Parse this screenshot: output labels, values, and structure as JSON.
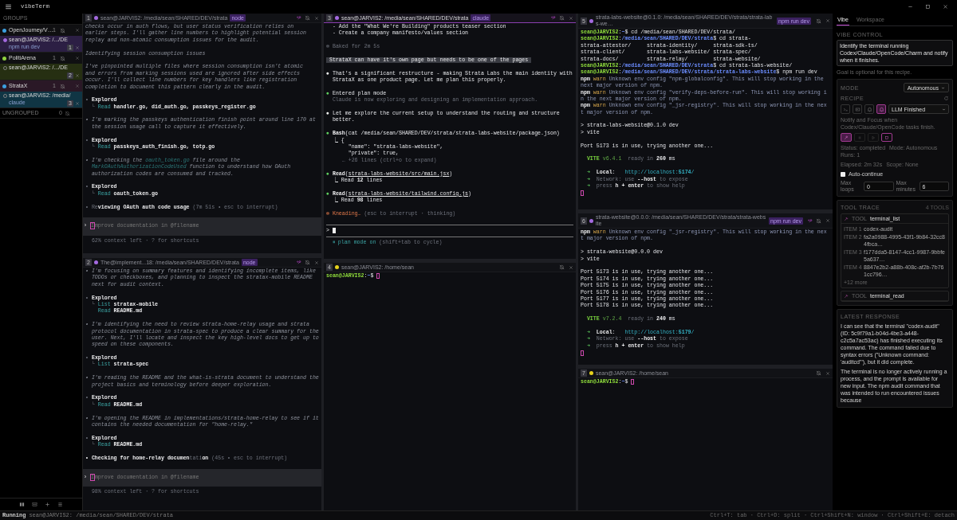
{
  "app": {
    "title": "vibeTerm"
  },
  "sidebar": {
    "heading": "GROUPS",
    "groups": [
      {
        "name": "OpenJourney/V…",
        "count": "1",
        "color": "#3b9fe0",
        "selected": false,
        "children": [
          {
            "title": "sean@JARVIS2: /.../DE",
            "subtitle": "npm run dev",
            "badge": "1",
            "color": "#2c1f44",
            "running": true
          }
        ]
      },
      {
        "name": "PolitiArena",
        "count": "1",
        "color": "#8fd13f",
        "selected": false,
        "children": [
          {
            "title": "sean@JARVIS2: /.../DE",
            "badge": "2",
            "color": "#262f12",
            "running": false
          }
        ]
      },
      {
        "name": "StrataX",
        "count": "1",
        "color": "#3b9fe0",
        "selected": true,
        "children": [
          {
            "title": "sean@JARVIS2: /media/",
            "subtitle": "claude",
            "badge": "3",
            "color": "#103544",
            "running": false
          }
        ]
      }
    ],
    "ungrouped": {
      "label": "UNGROUPED",
      "count": "0"
    }
  },
  "columns": [
    {
      "panes": [
        {
          "number": "1",
          "color": "#a46ae0",
          "title": "sean@JARVIS2: /media/sean/SHARED/DEV/strata",
          "tag": "node",
          "active": false,
          "watched": true,
          "blocks": [
            [
              [
                {
                  "kind": "thought",
                  "text": "checks occur in auth flows, but user status verification relies on"
                }
              ],
              [
                {
                  "kind": "thought",
                  "text": "earlier steps. I'll gather line numbers to highlight potential session"
                }
              ],
              [
                {
                  "kind": "thought",
                  "text": "replay and non-atomic consumption issues for the audit."
                }
              ]
            ],
            [
              [
                {
                  "kind": "thought",
                  "text": "Identifying session consumption issues"
                }
              ]
            ],
            [
              [
                {
                  "kind": "thought",
                  "text": "I've pinpointed multiple files where session consumption isn't atomic"
                }
              ],
              [
                {
                  "kind": "thought",
                  "text": "and errors from marking sessions used are ignored after side effects"
                }
              ],
              [
                {
                  "kind": "thought",
                  "text": "occur. I'll collect line numbers for key handlers like registration"
                }
              ],
              [
                {
                  "kind": "thought",
                  "text": "completion to document this pattern clearly in the audit."
                }
              ]
            ],
            [
              [
                {
                  "kind": "dim",
                  "text": "• "
                },
                {
                  "kind": "bold",
                  "text": "Explored"
                }
              ],
              [
                {
                  "kind": "dim",
                  "text": "  └ "
                },
                {
                  "kind": "teal",
                  "text": "Read"
                },
                {
                  "kind": "bold",
                  "text": " handler.go, did_auth.go, passkeys_register.go"
                }
              ]
            ],
            [
              [
                {
                  "kind": "thought",
                  "text": "• I'm marking the passkeys authentication finish point around line 170 at"
                }
              ],
              [
                {
                  "kind": "thought",
                  "text": "  the session usage call to capture it effectively."
                }
              ]
            ],
            [
              [
                {
                  "kind": "dim",
                  "text": "• "
                },
                {
                  "kind": "bold",
                  "text": "Explored"
                }
              ],
              [
                {
                  "kind": "dim",
                  "text": "  └ "
                },
                {
                  "kind": "teal",
                  "text": "Read"
                },
                {
                  "kind": "bold",
                  "text": " passkeys_auth_finish.go, totp.go"
                }
              ]
            ],
            [
              [
                {
                  "kind": "thought",
                  "text": "• I'm checking the "
                },
                {
                  "kind": "link",
                  "text": "oauth_token.go"
                },
                {
                  "kind": "thought",
                  "text": " file around the"
                }
              ],
              [
                {
                  "kind": "link",
                  "text": "  MarkOAuthAuthorizationCodeUsed"
                },
                {
                  "kind": "thought",
                  "text": " function to understand how OAuth"
                }
              ],
              [
                {
                  "kind": "thought",
                  "text": "  authorization codes are consumed and tracked."
                }
              ]
            ],
            [
              [
                {
                  "kind": "dim",
                  "text": "• "
                },
                {
                  "kind": "bold",
                  "text": "Explored"
                }
              ],
              [
                {
                  "kind": "dim",
                  "text": "  └ "
                },
                {
                  "kind": "teal",
                  "text": "Read"
                },
                {
                  "kind": "bold",
                  "text": " oauth_token.go"
                }
              ]
            ],
            [
              [
                {
                  "kind": "dim",
                  "text": "• Re"
                },
                {
                  "kind": "bold",
                  "text": "viewing OAuth auth code usage"
                },
                {
                  "kind": "dim",
                  "text": " (7m 51s • esc to interrupt)"
                }
              ]
            ]
          ],
          "input": {
            "kind": "codex",
            "prompt": "›",
            "placeholder": "Improve documentation in @filename"
          },
          "footer": [
            {
              "kind": "dim",
              "text": "  62% context left · ? for shortcuts"
            }
          ]
        },
        {
          "number": "2",
          "color": "#a46ae0",
          "title": "The@implement...18: /media/sean/SHARED/DEV/strata",
          "tag": "node",
          "active": false,
          "watched": true,
          "blocks": [
            [
              [
                {
                  "kind": "thought",
                  "text": "• I'm focusing on summary features and identifying incomplete items, like"
                }
              ],
              [
                {
                  "kind": "thought",
                  "text": "  TODOs or checkboxes, and planning to inspect the stratax-mobile README"
                }
              ],
              [
                {
                  "kind": "thought",
                  "text": "  next for audit context."
                }
              ]
            ],
            [
              [
                {
                  "kind": "dim",
                  "text": "• "
                },
                {
                  "kind": "bold",
                  "text": "Explored"
                }
              ],
              [
                {
                  "kind": "dim",
                  "text": "  └ "
                },
                {
                  "kind": "teal",
                  "text": "List"
                },
                {
                  "kind": "bold",
                  "text": " stratax-mobile"
                }
              ],
              [
                {
                  "kind": "teal",
                  "text": "    Read"
                },
                {
                  "kind": "bold",
                  "text": " README.md"
                }
              ]
            ],
            [
              [
                {
                  "kind": "thought",
                  "text": "• I'm identifying the need to review strata-home-relay usage and strata"
                }
              ],
              [
                {
                  "kind": "thought",
                  "text": "  protocol documentation in strata-spec to produce a clear summary for the"
                }
              ],
              [
                {
                  "kind": "thought",
                  "text": "  user. Next, I'll locate and inspect the key high-level docs to get up to"
                }
              ],
              [
                {
                  "kind": "thought",
                  "text": "  speed on these components."
                }
              ]
            ],
            [
              [
                {
                  "kind": "dim",
                  "text": "• "
                },
                {
                  "kind": "bold",
                  "text": "Explored"
                }
              ],
              [
                {
                  "kind": "dim",
                  "text": "  └ "
                },
                {
                  "kind": "teal",
                  "text": "List"
                },
                {
                  "kind": "bold",
                  "text": " strata-spec"
                }
              ]
            ],
            [
              [
                {
                  "kind": "thought",
                  "text": "• I'm reading the README and the what-is-strata document to understand the"
                }
              ],
              [
                {
                  "kind": "thought",
                  "text": "  project basics and terminology before deeper exploration."
                }
              ]
            ],
            [
              [
                {
                  "kind": "dim",
                  "text": "• "
                },
                {
                  "kind": "bold",
                  "text": "Explored"
                }
              ],
              [
                {
                  "kind": "dim",
                  "text": "  └ "
                },
                {
                  "kind": "teal",
                  "text": "Read"
                },
                {
                  "kind": "bold",
                  "text": " README.md"
                }
              ]
            ],
            [
              [
                {
                  "kind": "thought",
                  "text": "• I'm opening the README in implementations/strata-home-relay to see if it"
                }
              ],
              [
                {
                  "kind": "thought",
                  "text": "  contains the needed documentation for \"home-relay.\""
                }
              ]
            ],
            [
              [
                {
                  "kind": "dim",
                  "text": "• "
                },
                {
                  "kind": "bold",
                  "text": "Explored"
                }
              ],
              [
                {
                  "kind": "dim",
                  "text": "  └ "
                },
                {
                  "kind": "teal",
                  "text": "Read"
                },
                {
                  "kind": "bold",
                  "text": " README.md"
                }
              ]
            ],
            [
              [
                {
                  "kind": "bold",
                  "text": "• Checking for home-relay documen"
                },
                {
                  "kind": "dim",
                  "text": "tati"
                },
                {
                  "kind": "bold",
                  "text": "on"
                },
                {
                  "kind": "dim",
                  "text": " (45s • esc to interrupt)"
                }
              ]
            ]
          ],
          "input": {
            "kind": "codex",
            "prompt": "›",
            "placeholder": "Improve documentation in @filename"
          },
          "footer": [
            {
              "kind": "dim",
              "text": "  98% context left · ? for shortcuts"
            }
          ]
        }
      ]
    },
    {
      "panes": [
        {
          "number": "3",
          "color": "#a46ae0",
          "title": "sean@JARVIS2: /media/sean/SHARED/DEV/strata",
          "tag": "claude",
          "active": true,
          "watched": true,
          "blocks": [
            [
              [
                {
                  "kind": "white",
                  "text": "  - Add the \"What We're Building\" products teaser section"
                }
              ],
              [
                {
                  "kind": "white",
                  "text": "  - Create a company manifesto/values section"
                }
              ]
            ],
            [
              [
                {
                  "kind": "dim",
                  "text": "✻ Baked for 2m 5s"
                }
              ]
            ],
            [
              [
                {
                  "kind": "highlight",
                  "text": " StrataX can have it's own page but needs to be one of the pages "
                }
              ]
            ],
            [
              [
                {
                  "kind": "bullet",
                  "text": "● "
                },
                {
                  "kind": "white",
                  "text": "That's a significant restructure - making Strata Labs the main identity with"
                }
              ],
              [
                {
                  "kind": "white",
                  "text": "  StrataX as one product page. Let me plan this properly."
                }
              ]
            ],
            [
              [
                {
                  "kind": "bullet-ok",
                  "text": "● "
                },
                {
                  "kind": "white",
                  "text": "Entered plan mode"
                }
              ],
              [
                {
                  "kind": "dim",
                  "text": "  Claude is now exploring and designing an implementation approach."
                }
              ]
            ],
            [
              [
                {
                  "kind": "bullet",
                  "text": "● "
                },
                {
                  "kind": "white",
                  "text": "Let me explore the current setup to understand the routing and structure"
                }
              ],
              [
                {
                  "kind": "white",
                  "text": "  better."
                }
              ]
            ],
            [
              [
                {
                  "kind": "bullet-ok",
                  "text": "● "
                },
                {
                  "kind": "bold",
                  "text": "Bash"
                },
                {
                  "kind": "white",
                  "text": "(cat /media/sean/SHARED/DEV/strata/strata-labs-website/package.json)"
                }
              ],
              [
                {
                  "kind": "white",
                  "text": "  ⎿ {"
                }
              ],
              [
                {
                  "kind": "white",
                  "text": "       \"name\": \"strata-labs-website\","
                }
              ],
              [
                {
                  "kind": "white",
                  "text": "       \"private\": true,"
                }
              ],
              [
                {
                  "kind": "dim",
                  "text": "     … +26 lines (ctrl+o to expand)"
                }
              ]
            ],
            [
              [
                {
                  "kind": "bullet-ok",
                  "text": "● "
                },
                {
                  "kind": "bold",
                  "text": "Read"
                },
                {
                  "kind": "white",
                  "text": "("
                },
                {
                  "kind": "underline",
                  "text": "strata-labs-website/src/main.jsx"
                },
                {
                  "kind": "white",
                  "text": ")"
                }
              ],
              [
                {
                  "kind": "white",
                  "text": "  ⎿ Read "
                },
                {
                  "kind": "bold",
                  "text": "12"
                },
                {
                  "kind": "white",
                  "text": " lines"
                }
              ]
            ],
            [
              [
                {
                  "kind": "bullet-ok",
                  "text": "● "
                },
                {
                  "kind": "bold",
                  "text": "Read"
                },
                {
                  "kind": "white",
                  "text": "("
                },
                {
                  "kind": "underline",
                  "text": "strata-labs-website/tailwind.config.js"
                },
                {
                  "kind": "white",
                  "text": ")"
                }
              ],
              [
                {
                  "kind": "white",
                  "text": "  ⎿ Read "
                },
                {
                  "kind": "bold",
                  "text": "98"
                },
                {
                  "kind": "white",
                  "text": " lines"
                }
              ]
            ],
            [
              [
                {
                  "kind": "orange",
                  "text": "✻ Kneading…"
                },
                {
                  "kind": "dim",
                  "text": " (esc to interrupt · thinking)"
                }
              ]
            ]
          ],
          "input": {
            "kind": "claude",
            "prompt": ">"
          },
          "footer": [
            {
              "kind": "teal",
              "text": "  ⏸ plan mode on"
            },
            {
              "kind": "dim",
              "text": " (shift+tab to cycle)"
            }
          ]
        },
        {
          "number": "4",
          "color": "#e6d21c",
          "title": "sean@JARVIS2: /home/sean",
          "active": false,
          "watched": false,
          "blocks": [
            [
              [
                {
                  "kind": "prompt",
                  "text": "sean@JARVIS2"
                },
                {
                  "kind": "white",
                  "text": ":"
                },
                {
                  "kind": "path",
                  "text": "~"
                },
                {
                  "kind": "white",
                  "text": "$ "
                },
                {
                  "kind": "cursor"
                }
              ]
            ]
          ]
        }
      ]
    },
    {
      "panes": [
        {
          "number": "5",
          "color": "#a46ae0",
          "title": "strata-labs-website@0.1.0: /media/sean/SHARED/DEV/strata/strata-labs-we…",
          "tag": "npm run dev",
          "active": false,
          "watched": false,
          "blocks": [
            [
              [
                {
                  "kind": "prompt",
                  "text": "sean@JARVIS2"
                },
                {
                  "kind": "white",
                  "text": ":"
                },
                {
                  "kind": "path",
                  "text": "~"
                },
                {
                  "kind": "white",
                  "text": "$ cd /media/sean/SHARED/DEV/strata/"
                }
              ],
              [
                {
                  "kind": "prompt",
                  "text": "sean@JARVIS2"
                },
                {
                  "kind": "white",
                  "text": ":"
                },
                {
                  "kind": "path",
                  "text": "/media/sean/SHARED/DEV/strata"
                },
                {
                  "kind": "white",
                  "text": "$ cd strata-"
                }
              ],
              [
                {
                  "kind": "white",
                  "text": "strata-attestor/     strata-identity/     strata-sdk-ts/"
                }
              ],
              [
                {
                  "kind": "white",
                  "text": "strata-client/       strata-labs-website/ strata-spec/"
                }
              ],
              [
                {
                  "kind": "white",
                  "text": "strata-docs/         strata-relay/        strata-website/"
                }
              ],
              [
                {
                  "kind": "prompt",
                  "text": "sean@JARVIS2"
                },
                {
                  "kind": "white",
                  "text": ":"
                },
                {
                  "kind": "path",
                  "text": "/media/sean/SHARED/DEV/strata"
                },
                {
                  "kind": "white",
                  "text": "$ cd strata-labs-website/"
                }
              ],
              [
                {
                  "kind": "prompt",
                  "text": "sean@JARVIS2"
                },
                {
                  "kind": "white",
                  "text": ":"
                },
                {
                  "kind": "path",
                  "text": "/media/sean/SHARED/DEV/strata/strata-labs-website"
                },
                {
                  "kind": "white",
                  "text": "$ npm run dev"
                }
              ],
              [
                {
                  "kind": "bold",
                  "text": "npm"
                },
                {
                  "kind": "warn",
                  "text": " warn"
                },
                {
                  "kind": "note",
                  "text": " Unknown env config \"npm-globalconfig\". This will stop working in the"
                }
              ],
              [
                {
                  "kind": "note",
                  "text": "next major version of npm."
                }
              ],
              [
                {
                  "kind": "bold",
                  "text": "npm"
                },
                {
                  "kind": "warn",
                  "text": " warn"
                },
                {
                  "kind": "note",
                  "text": " Unknown env config \"verify-deps-before-run\". This will stop working i"
                }
              ],
              [
                {
                  "kind": "note",
                  "text": "n the next major version of npm."
                }
              ],
              [
                {
                  "kind": "bold",
                  "text": "npm"
                },
                {
                  "kind": "warn",
                  "text": " warn"
                },
                {
                  "kind": "note",
                  "text": " Unknown env config \"_jsr-registry\". This will stop working in the nex"
                }
              ],
              [
                {
                  "kind": "note",
                  "text": "t major version of npm."
                }
              ]
            ],
            [
              [
                {
                  "kind": "white",
                  "text": "> strata-labs-website@0.1.0 dev"
                }
              ],
              [
                {
                  "kind": "white",
                  "text": "> vite"
                }
              ]
            ],
            [
              [
                {
                  "kind": "white",
                  "text": "Port 5173 is in use, trying another one..."
                }
              ]
            ],
            [
              [
                {
                  "kind": "vite",
                  "text": "  VITE"
                },
                {
                  "kind": "version",
                  "text": " v6.4.1"
                },
                {
                  "kind": "dim",
                  "text": "  ready in "
                },
                {
                  "kind": "bold",
                  "text": "260"
                },
                {
                  "kind": "white",
                  "text": " ms"
                }
              ]
            ],
            [
              [
                {
                  "kind": "green",
                  "text": "  ➜  "
                },
                {
                  "kind": "bold",
                  "text": "Local"
                },
                {
                  "kind": "white",
                  "text": ":   "
                },
                {
                  "kind": "url",
                  "text": "http://localhost:"
                },
                {
                  "kind": "urlbold",
                  "text": "5174"
                },
                {
                  "kind": "url",
                  "text": "/"
                }
              ],
              [
                {
                  "kind": "green",
                  "text": "  ➜  "
                },
                {
                  "kind": "dim",
                  "text": "Network: use "
                },
                {
                  "kind": "bold",
                  "text": "--host"
                },
                {
                  "kind": "dim",
                  "text": " to expose"
                }
              ],
              [
                {
                  "kind": "green",
                  "text": "  ➜  "
                },
                {
                  "kind": "dim",
                  "text": "press "
                },
                {
                  "kind": "bold",
                  "text": "h + enter"
                },
                {
                  "kind": "dim",
                  "text": " to show help"
                }
              ],
              [
                {
                  "kind": "cursor"
                }
              ]
            ]
          ]
        },
        {
          "number": "6",
          "color": "#a46ae0",
          "title": "strata-website@0.0.0: /media/sean/SHARED/DEV/strata/strata-website",
          "tag": "npm run dev",
          "active": false,
          "watched": true,
          "blocks": [
            [
              [
                {
                  "kind": "bold",
                  "text": "npm"
                },
                {
                  "kind": "warn",
                  "text": " warn"
                },
                {
                  "kind": "note",
                  "text": " Unknown env config \"_jsr-registry\". This will stop working in the nex"
                }
              ],
              [
                {
                  "kind": "note",
                  "text": "t major version of npm."
                }
              ]
            ],
            [
              [
                {
                  "kind": "white",
                  "text": "> strata-website@0.0.0 dev"
                }
              ],
              [
                {
                  "kind": "white",
                  "text": "> vite"
                }
              ]
            ],
            [
              [
                {
                  "kind": "white",
                  "text": "Port 5173 is in use, trying another one..."
                }
              ],
              [
                {
                  "kind": "white",
                  "text": "Port 5174 is in use, trying another one..."
                }
              ],
              [
                {
                  "kind": "white",
                  "text": "Port 5175 is in use, trying another one..."
                }
              ],
              [
                {
                  "kind": "white",
                  "text": "Port 5176 is in use, trying another one..."
                }
              ],
              [
                {
                  "kind": "white",
                  "text": "Port 5177 is in use, trying another one..."
                }
              ],
              [
                {
                  "kind": "white",
                  "text": "Port 5178 is in use, trying another one..."
                }
              ]
            ],
            [
              [
                {
                  "kind": "vite",
                  "text": "  VITE"
                },
                {
                  "kind": "version",
                  "text": " v7.2.4"
                },
                {
                  "kind": "dim",
                  "text": "  ready in "
                },
                {
                  "kind": "bold",
                  "text": "240"
                },
                {
                  "kind": "white",
                  "text": " ms"
                }
              ]
            ],
            [
              [
                {
                  "kind": "green",
                  "text": "  ➜  "
                },
                {
                  "kind": "bold",
                  "text": "Local"
                },
                {
                  "kind": "white",
                  "text": ":   "
                },
                {
                  "kind": "url",
                  "text": "http://localhost:"
                },
                {
                  "kind": "urlbold",
                  "text": "5179"
                },
                {
                  "kind": "url",
                  "text": "/"
                }
              ],
              [
                {
                  "kind": "green",
                  "text": "  ➜  "
                },
                {
                  "kind": "dim",
                  "text": "Network: use "
                },
                {
                  "kind": "bold",
                  "text": "--host"
                },
                {
                  "kind": "dim",
                  "text": " to expose"
                }
              ],
              [
                {
                  "kind": "green",
                  "text": "  ➜  "
                },
                {
                  "kind": "dim",
                  "text": "press "
                },
                {
                  "kind": "bold",
                  "text": "h + enter"
                },
                {
                  "kind": "dim",
                  "text": " to show help"
                }
              ],
              [
                {
                  "kind": "cursor"
                }
              ]
            ]
          ]
        },
        {
          "number": "7",
          "color": "#e6d21c",
          "title": "sean@JARVIS2: /home/sean",
          "active": false,
          "watched": false,
          "blocks": [
            [
              [
                {
                  "kind": "prompt",
                  "text": "sean@JARVIS2"
                },
                {
                  "kind": "white",
                  "text": ":"
                },
                {
                  "kind": "path",
                  "text": "~"
                },
                {
                  "kind": "white",
                  "text": "$ "
                },
                {
                  "kind": "cursor"
                }
              ]
            ]
          ]
        }
      ]
    }
  ],
  "vibe_panel": {
    "tabs": [
      {
        "label": "Vibe",
        "selected": true
      },
      {
        "label": "Workspace",
        "selected": false
      }
    ],
    "heading": "VIBE CONTROL",
    "goal": "Identify the terminal running Codex/Claude/OpenCode/Charm and notify when it finishes.",
    "goal_hint": "Goal is optional for this recipe.",
    "mode": {
      "label": "MODE",
      "value": "Autonomous"
    },
    "recipe": {
      "label": "RECIPE",
      "buttons": [
        {
          "kind": "terminal",
          "selected": false
        },
        {
          "kind": "id",
          "selected": false
        },
        {
          "kind": "bell",
          "selected": false
        },
        {
          "kind": "bell",
          "selected": true
        }
      ],
      "value": "LLM Finished",
      "description": "Notify and Focus when Codex/Claude/OpenCode tasks finish."
    },
    "actions": [
      {
        "kind": "magic",
        "selected": true,
        "disabled": false
      },
      {
        "kind": "pause",
        "selected": false,
        "disabled": true
      },
      {
        "kind": "play",
        "selected": false,
        "disabled": true
      },
      {
        "kind": "stop",
        "selected": false,
        "disabled": false
      }
    ],
    "stats": [
      [
        "Status: completed",
        "Mode: Autonomous",
        "Runs: 1"
      ],
      [
        "Elapsed: 2m 32s",
        "Scope: None"
      ]
    ],
    "auto_continue": {
      "label": "Auto-continue",
      "checked": false
    },
    "limits": [
      {
        "label": "Max loops",
        "value": "0"
      },
      {
        "label": "Max minutes",
        "value": "6"
      }
    ],
    "tool_trace": {
      "heading": "TOOL TRACE",
      "count": "4 TOOLS",
      "tools": [
        {
          "tag": "TOOL",
          "name": "terminal_list",
          "items": [
            {
              "label": "ITEM 1",
              "value": "codex-audit"
            },
            {
              "label": "ITEM 2",
              "value": "fa2a0988-4995-43f1-9b84-32cc84fbca…"
            },
            {
              "label": "ITEM 3",
              "value": "f177dda5-8147-4cc1-9987-9bbfe5a637…"
            },
            {
              "label": "ITEM 4",
              "value": "8847e2b2-a88b-408c-af2b-7b761cc796…"
            }
          ],
          "more": "+12 more"
        },
        {
          "tag": "TOOL",
          "name": "terminal_read"
        }
      ]
    },
    "latest_response": {
      "heading": "LATEST RESPONSE",
      "paragraphs": [
        "I can see that the terminal \"codex-audit\" (ID: 5c9f79a1-b04d-4be3-a448-c2c5a7ac53ac) has finished executing its command. The command failed due to syntax errors (\"Unknown command: 'auditcd'\"), but it did complete.",
        "The terminal is no longer actively running a process, and the prompt is available for new input. The npm audit command that was intended to run encountered issues because"
      ]
    }
  },
  "status_bar": {
    "state": "Running",
    "path": "sean@JARVIS2: /media/sean/SHARED/DEV/strata",
    "shortcuts": "Ctrl+T: tab · Ctrl+D: split · Ctrl+Shift+N: window · Ctrl+Shift+E: detach"
  }
}
